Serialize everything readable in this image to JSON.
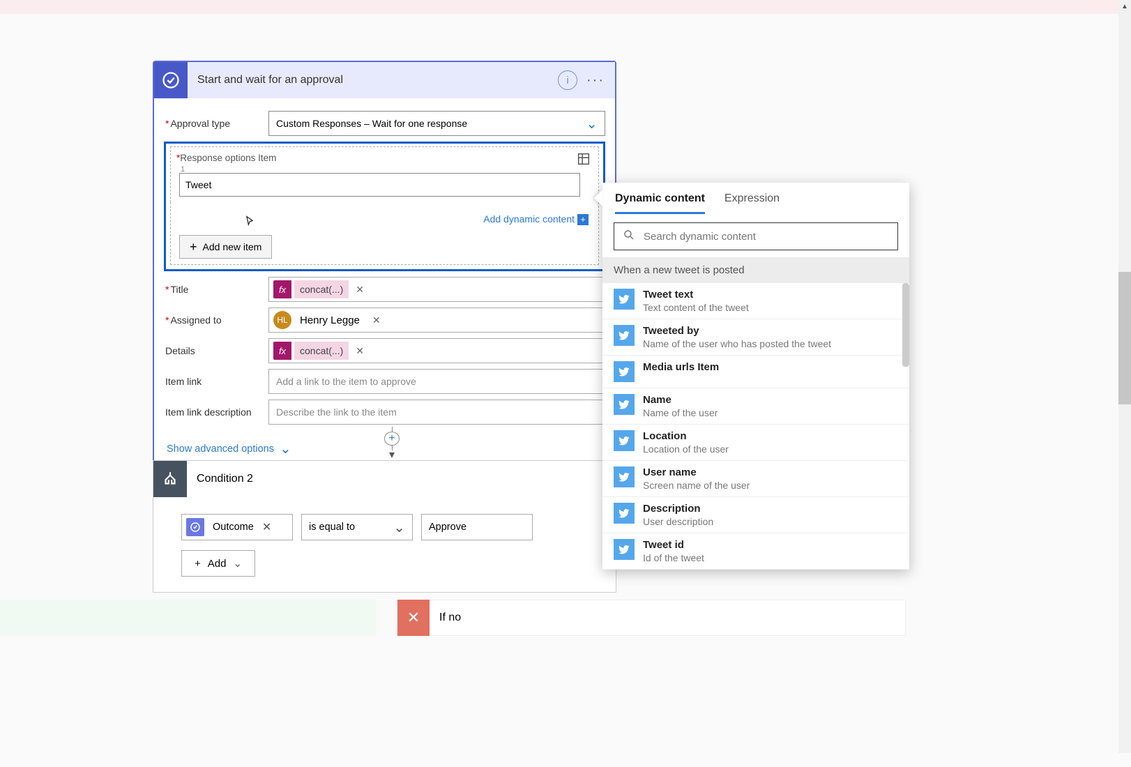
{
  "card1": {
    "title": "Start and wait for an approval",
    "approval_type": {
      "label": "Approval type",
      "value": "Custom Responses – Wait for one response"
    },
    "response_options": {
      "label": "Response options Item",
      "index": "1",
      "value": "Tweet",
      "add_dynamic": "Add dynamic content",
      "add_item_btn": "Add new item"
    },
    "title_field": {
      "label": "Title",
      "token": "concat(...)"
    },
    "assigned": {
      "label": "Assigned to",
      "initials": "HL",
      "name": "Henry Legge"
    },
    "details": {
      "label": "Details",
      "token": "concat(...)"
    },
    "item_link": {
      "label": "Item link",
      "placeholder": "Add a link to the item to approve"
    },
    "item_link_desc": {
      "label": "Item link description",
      "placeholder": "Describe the link to the item"
    },
    "show_advanced": "Show advanced options"
  },
  "card2": {
    "title": "Condition 2",
    "outcome_label": "Outcome",
    "operator": "is equal to",
    "value": "Approve",
    "add_btn": "Add"
  },
  "branches": {
    "if_no": "If no"
  },
  "dynamic": {
    "tabs": {
      "content": "Dynamic content",
      "expression": "Expression"
    },
    "search_placeholder": "Search dynamic content",
    "section_header": "When a new tweet is posted",
    "items": [
      {
        "t": "Tweet text",
        "d": "Text content of the tweet"
      },
      {
        "t": "Tweeted by",
        "d": "Name of the user who has posted the tweet"
      },
      {
        "t": "Media urls Item",
        "d": ""
      },
      {
        "t": "Name",
        "d": "Name of the user"
      },
      {
        "t": "Location",
        "d": "Location of the user"
      },
      {
        "t": "User name",
        "d": "Screen name of the user"
      },
      {
        "t": "Description",
        "d": "User description"
      },
      {
        "t": "Tweet id",
        "d": "Id of the tweet"
      }
    ]
  }
}
